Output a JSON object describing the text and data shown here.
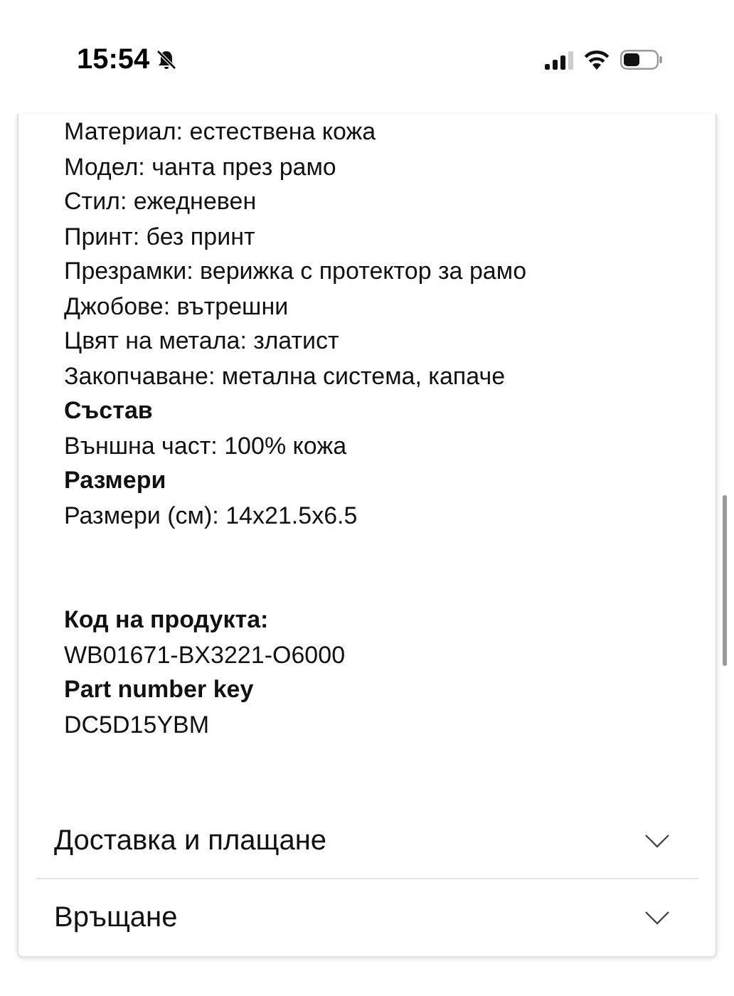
{
  "status_bar": {
    "time": "15:54",
    "silent": true
  },
  "details": [
    {
      "kind": "text",
      "text": "Материал: естествена кожа"
    },
    {
      "kind": "text",
      "text": "Модел: чанта през рамо"
    },
    {
      "kind": "text",
      "text": "Стил: ежедневен"
    },
    {
      "kind": "text",
      "text": "Принт: без принт"
    },
    {
      "kind": "text",
      "text": "Презрамки: верижка с протектор за рамо"
    },
    {
      "kind": "text",
      "text": "Джобове: вътрешни"
    },
    {
      "kind": "text",
      "text": "Цвят на метала: златист"
    },
    {
      "kind": "text",
      "text": "Закопчаване: метална система, капаче"
    },
    {
      "kind": "heading",
      "text": "Състав"
    },
    {
      "kind": "text",
      "text": "Външна част: 100% кожа"
    },
    {
      "kind": "heading",
      "text": "Размери"
    },
    {
      "kind": "text",
      "text": "Размери (см): 14x21.5x6.5"
    }
  ],
  "codes": [
    {
      "kind": "heading",
      "text": "Код на продукта:"
    },
    {
      "kind": "text",
      "text": "WB01671-BX3221-O6000"
    },
    {
      "kind": "heading",
      "text": "Part number key"
    },
    {
      "kind": "text",
      "text": "DC5D15YBM"
    }
  ],
  "accordion": [
    {
      "label": "Доставка и плащане",
      "expanded": false
    },
    {
      "label": "Връщане",
      "expanded": false
    }
  ]
}
